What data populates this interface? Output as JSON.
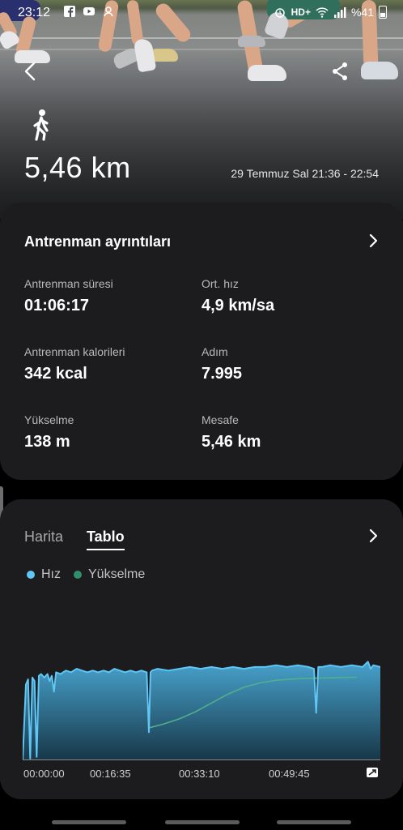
{
  "status_bar": {
    "time": "23:12",
    "network": "HD+",
    "battery_percent": "%41"
  },
  "header": {
    "activity_icon": "walking-person-icon",
    "distance": "5,46 km",
    "date_range": "29 Temmuz Sal 21:36 - 22:54"
  },
  "details": {
    "title": "Antrenman ayrıntıları",
    "stats": [
      {
        "label": "Antrenman süresi",
        "value": "01:06:17"
      },
      {
        "label": "Ort. hız",
        "value": "4,9 km/sa"
      },
      {
        "label": "Antrenman kalorileri",
        "value": "342 kcal"
      },
      {
        "label": "Adım",
        "value": "7.995"
      },
      {
        "label": "Yükselme",
        "value": "138 m"
      },
      {
        "label": "Mesafe",
        "value": "5,46 km"
      }
    ]
  },
  "graph_card": {
    "tabs": [
      {
        "label": "Harita",
        "selected": false
      },
      {
        "label": "Tablo",
        "selected": true
      }
    ],
    "legend": [
      {
        "label": "Hız",
        "color": "#5fc6f5"
      },
      {
        "label": "Yükselme",
        "color": "#2f8f6a"
      }
    ]
  },
  "chart_data": {
    "type": "area",
    "title": "",
    "xlabel": "",
    "ylabel": "",
    "x_ticks": [
      "00:00:00",
      "00:16:35",
      "00:33:10",
      "00:49:45"
    ],
    "x_unit": "minutes",
    "xlim": [
      0,
      66.3
    ],
    "ylim": [
      0,
      7
    ],
    "series": [
      {
        "name": "Hız",
        "color": "#5fc6f5",
        "x": [
          0,
          0.6,
          1.0,
          1.4,
          1.8,
          2.2,
          2.6,
          3.0,
          3.4,
          4.0,
          4.6,
          5.0,
          5.4,
          5.8,
          6.2,
          7.0,
          8.0,
          9.0,
          10.0,
          11.0,
          12.0,
          13.0,
          14.0,
          15.0,
          16.0,
          17.0,
          18.0,
          19.0,
          20.0,
          21.0,
          22.0,
          23.0,
          23.4,
          23.7,
          24.0,
          25.0,
          27.0,
          29.0,
          31.0,
          33.0,
          35.0,
          37.0,
          39.0,
          41.0,
          43.0,
          45.0,
          47.0,
          49.0,
          51.0,
          53.0,
          54.0,
          54.4,
          54.8,
          55.5,
          57.0,
          59.0,
          61.0,
          63.0,
          64.0,
          64.5,
          65.0,
          66.3
        ],
        "y": [
          0,
          4.3,
          4.6,
          0.1,
          4.7,
          4.5,
          0.2,
          4.8,
          4.9,
          4.7,
          4.9,
          4.5,
          4.8,
          3.9,
          5.0,
          4.9,
          5.1,
          5.0,
          5.2,
          5.1,
          5.0,
          5.1,
          5.0,
          5.1,
          5.0,
          5.2,
          5.1,
          5.0,
          5.1,
          5.0,
          5.1,
          5.0,
          1.6,
          5.0,
          5.1,
          5.2,
          5.1,
          5.2,
          5.3,
          5.2,
          5.3,
          5.2,
          5.3,
          5.2,
          5.3,
          5.3,
          5.4,
          5.3,
          5.4,
          5.3,
          5.2,
          2.7,
          5.3,
          5.3,
          5.4,
          5.3,
          5.4,
          5.3,
          5.6,
          5.2,
          5.4,
          5.3
        ]
      },
      {
        "name": "Yükselme",
        "color": "#2f8f6a",
        "x": [
          23.5,
          26,
          29,
          32,
          35,
          38,
          41,
          44,
          47,
          50,
          53,
          56,
          59,
          62
        ],
        "y": [
          1.85,
          2.05,
          2.35,
          2.75,
          3.25,
          3.75,
          4.15,
          4.4,
          4.55,
          4.62,
          4.66,
          4.68,
          4.7,
          4.72
        ]
      }
    ],
    "grid": false,
    "legend_position": "top-left"
  }
}
